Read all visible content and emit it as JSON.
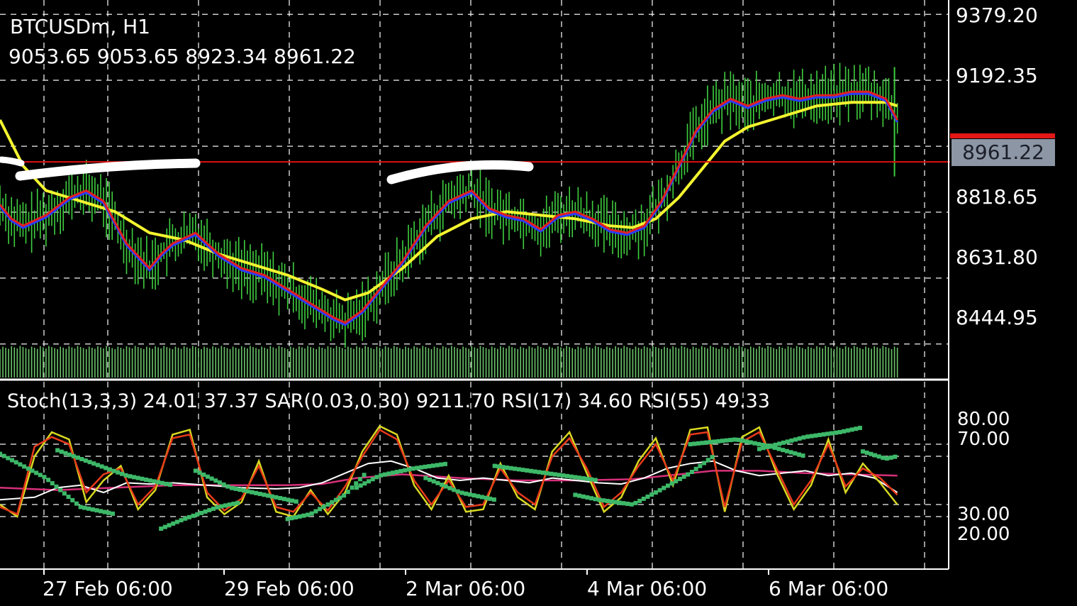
{
  "header": {
    "symbol": "BTCUSDm, H1",
    "ohlc": "9053.65 9053.65 8923.34 8961.22"
  },
  "subwindow": {
    "label": "Stoch(13,3,3) 24.01 37.37 SAR(0.03,0.30) 9211.70 RSI(17) 34.60 RSI(55) 49.33"
  },
  "price_axis": [
    "9379.20",
    "9192.35",
    "8818.65",
    "8631.80",
    "8444.95"
  ],
  "current_price": "8961.22",
  "osc_axis": [
    "80.00",
    "70.00",
    "30.00",
    "20.00"
  ],
  "time_axis": [
    "27 Feb 06:00",
    "29 Feb 06:00",
    "2 Mar 06:00",
    "4 Mar 06:00",
    "6 Mar 06:00"
  ],
  "colors": {
    "background": "#000000",
    "grid": "#ffffff",
    "candles": "#3fcf3f",
    "fast_ma": "#e02020",
    "mid_ma": "#2a3cff",
    "slow_ma": "#f4f430",
    "volume": "#6ac46a",
    "stoch_main": "#e83a1a",
    "stoch_signal": "#d8d822",
    "sar_dots": "#3db868",
    "rsi_fast": "#ffffff",
    "rsi_slow": "#d6307a",
    "current_line": "#e01010"
  },
  "chart_data": {
    "type": "line",
    "title": "BTCUSDm, H1",
    "ylim": [
      8350,
      9420
    ],
    "current": 8961.22,
    "price_path": [
      [
        0,
        8840
      ],
      [
        2,
        8800
      ],
      [
        4,
        8780
      ],
      [
        8,
        8810
      ],
      [
        12,
        8860
      ],
      [
        15,
        8880
      ],
      [
        18,
        8850
      ],
      [
        22,
        8730
      ],
      [
        26,
        8660
      ],
      [
        28,
        8700
      ],
      [
        30,
        8730
      ],
      [
        34,
        8760
      ],
      [
        38,
        8700
      ],
      [
        42,
        8660
      ],
      [
        46,
        8640
      ],
      [
        50,
        8600
      ],
      [
        54,
        8560
      ],
      [
        58,
        8520
      ],
      [
        60,
        8505
      ],
      [
        63,
        8540
      ],
      [
        66,
        8600
      ],
      [
        70,
        8680
      ],
      [
        74,
        8780
      ],
      [
        78,
        8850
      ],
      [
        82,
        8880
      ],
      [
        85,
        8830
      ],
      [
        88,
        8810
      ],
      [
        91,
        8800
      ],
      [
        94,
        8770
      ],
      [
        97,
        8810
      ],
      [
        100,
        8820
      ],
      [
        103,
        8800
      ],
      [
        106,
        8770
      ],
      [
        109,
        8760
      ],
      [
        112,
        8780
      ],
      [
        115,
        8850
      ],
      [
        118,
        8950
      ],
      [
        121,
        9050
      ],
      [
        124,
        9110
      ],
      [
        127,
        9140
      ],
      [
        130,
        9120
      ],
      [
        133,
        9140
      ],
      [
        136,
        9150
      ],
      [
        139,
        9140
      ],
      [
        142,
        9150
      ],
      [
        145,
        9150
      ],
      [
        148,
        9160
      ],
      [
        151,
        9160
      ],
      [
        154,
        9140
      ],
      [
        156,
        9080
      ]
    ],
    "slow_path": [
      [
        0,
        9080
      ],
      [
        4,
        8950
      ],
      [
        8,
        8880
      ],
      [
        14,
        8850
      ],
      [
        20,
        8820
      ],
      [
        26,
        8760
      ],
      [
        32,
        8740
      ],
      [
        38,
        8700
      ],
      [
        44,
        8670
      ],
      [
        50,
        8640
      ],
      [
        56,
        8600
      ],
      [
        60,
        8570
      ],
      [
        64,
        8590
      ],
      [
        70,
        8660
      ],
      [
        76,
        8750
      ],
      [
        82,
        8800
      ],
      [
        88,
        8820
      ],
      [
        94,
        8810
      ],
      [
        100,
        8800
      ],
      [
        106,
        8780
      ],
      [
        110,
        8775
      ],
      [
        114,
        8800
      ],
      [
        118,
        8860
      ],
      [
        122,
        8940
      ],
      [
        126,
        9020
      ],
      [
        130,
        9060
      ],
      [
        136,
        9090
      ],
      [
        142,
        9120
      ],
      [
        148,
        9130
      ],
      [
        154,
        9130
      ],
      [
        156,
        9120
      ]
    ],
    "stochastic": {
      "range": [
        0,
        100
      ],
      "main": [
        [
          0,
          28
        ],
        [
          3,
          22
        ],
        [
          6,
          78
        ],
        [
          9,
          86
        ],
        [
          12,
          80
        ],
        [
          15,
          40
        ],
        [
          18,
          55
        ],
        [
          21,
          60
        ],
        [
          24,
          30
        ],
        [
          27,
          45
        ],
        [
          30,
          85
        ],
        [
          33,
          88
        ],
        [
          36,
          40
        ],
        [
          39,
          25
        ],
        [
          42,
          35
        ],
        [
          45,
          62
        ],
        [
          48,
          28
        ],
        [
          51,
          24
        ],
        [
          54,
          40
        ],
        [
          57,
          25
        ],
        [
          60,
          45
        ],
        [
          63,
          70
        ],
        [
          66,
          92
        ],
        [
          69,
          84
        ],
        [
          72,
          50
        ],
        [
          75,
          30
        ],
        [
          78,
          50
        ],
        [
          81,
          28
        ],
        [
          84,
          30
        ],
        [
          87,
          60
        ],
        [
          90,
          40
        ],
        [
          93,
          30
        ],
        [
          96,
          70
        ],
        [
          99,
          85
        ],
        [
          102,
          60
        ],
        [
          105,
          28
        ],
        [
          108,
          40
        ],
        [
          111,
          62
        ],
        [
          114,
          80
        ],
        [
          117,
          50
        ],
        [
          120,
          88
        ],
        [
          123,
          90
        ],
        [
          126,
          28
        ],
        [
          129,
          82
        ],
        [
          132,
          90
        ],
        [
          135,
          60
        ],
        [
          138,
          30
        ],
        [
          141,
          50
        ],
        [
          144,
          80
        ],
        [
          147,
          45
        ],
        [
          150,
          60
        ],
        [
          153,
          52
        ],
        [
          156,
          38
        ]
      ],
      "signal": [
        [
          0,
          30
        ],
        [
          3,
          20
        ],
        [
          6,
          70
        ],
        [
          9,
          90
        ],
        [
          12,
          84
        ],
        [
          15,
          32
        ],
        [
          18,
          50
        ],
        [
          21,
          62
        ],
        [
          24,
          26
        ],
        [
          27,
          42
        ],
        [
          30,
          88
        ],
        [
          33,
          92
        ],
        [
          36,
          36
        ],
        [
          39,
          22
        ],
        [
          42,
          32
        ],
        [
          45,
          66
        ],
        [
          48,
          24
        ],
        [
          51,
          20
        ],
        [
          54,
          42
        ],
        [
          57,
          22
        ],
        [
          60,
          40
        ],
        [
          63,
          74
        ],
        [
          66,
          95
        ],
        [
          69,
          88
        ],
        [
          72,
          46
        ],
        [
          75,
          26
        ],
        [
          78,
          54
        ],
        [
          81,
          24
        ],
        [
          84,
          26
        ],
        [
          87,
          64
        ],
        [
          90,
          36
        ],
        [
          93,
          26
        ],
        [
          96,
          74
        ],
        [
          99,
          90
        ],
        [
          102,
          56
        ],
        [
          105,
          24
        ],
        [
          108,
          36
        ],
        [
          111,
          66
        ],
        [
          114,
          85
        ],
        [
          117,
          46
        ],
        [
          120,
          92
        ],
        [
          123,
          94
        ],
        [
          126,
          24
        ],
        [
          129,
          86
        ],
        [
          132,
          94
        ],
        [
          135,
          56
        ],
        [
          138,
          26
        ],
        [
          141,
          46
        ],
        [
          144,
          84
        ],
        [
          147,
          40
        ],
        [
          150,
          64
        ],
        [
          153,
          48
        ],
        [
          156,
          30
        ]
      ]
    },
    "rsi17": [
      [
        0,
        34
      ],
      [
        6,
        36
      ],
      [
        10,
        44
      ],
      [
        14,
        46
      ],
      [
        18,
        40
      ],
      [
        22,
        48
      ],
      [
        26,
        47
      ],
      [
        30,
        48
      ],
      [
        36,
        46
      ],
      [
        42,
        44
      ],
      [
        48,
        43
      ],
      [
        52,
        44
      ],
      [
        56,
        48
      ],
      [
        60,
        56
      ],
      [
        64,
        64
      ],
      [
        68,
        66
      ],
      [
        72,
        60
      ],
      [
        76,
        52
      ],
      [
        80,
        50
      ],
      [
        84,
        52
      ],
      [
        88,
        50
      ],
      [
        92,
        48
      ],
      [
        96,
        52
      ],
      [
        100,
        50
      ],
      [
        104,
        48
      ],
      [
        108,
        47
      ],
      [
        112,
        52
      ],
      [
        116,
        60
      ],
      [
        120,
        64
      ],
      [
        124,
        66
      ],
      [
        128,
        58
      ],
      [
        132,
        54
      ],
      [
        136,
        56
      ],
      [
        140,
        58
      ],
      [
        144,
        54
      ],
      [
        148,
        56
      ],
      [
        152,
        52
      ],
      [
        156,
        40
      ]
    ],
    "rsi55": [
      [
        0,
        44
      ],
      [
        10,
        42
      ],
      [
        20,
        44
      ],
      [
        30,
        46
      ],
      [
        40,
        46
      ],
      [
        50,
        46
      ],
      [
        56,
        47
      ],
      [
        62,
        52
      ],
      [
        70,
        55
      ],
      [
        80,
        52
      ],
      [
        90,
        50
      ],
      [
        100,
        50
      ],
      [
        110,
        51
      ],
      [
        116,
        54
      ],
      [
        124,
        58
      ],
      [
        132,
        58
      ],
      [
        140,
        56
      ],
      [
        148,
        55
      ],
      [
        156,
        54
      ]
    ],
    "sar_segments": [
      [
        [
          0,
          72
        ],
        [
          8,
          52
        ],
        [
          14,
          28
        ],
        [
          20,
          22
        ]
      ],
      [
        [
          10,
          75
        ],
        [
          14,
          68
        ],
        [
          22,
          54
        ],
        [
          30,
          46
        ]
      ],
      [
        [
          28,
          10
        ],
        [
          32,
          18
        ],
        [
          38,
          28
        ],
        [
          42,
          32
        ]
      ],
      [
        [
          34,
          58
        ],
        [
          40,
          44
        ],
        [
          46,
          38
        ],
        [
          52,
          32
        ]
      ],
      [
        [
          50,
          18
        ],
        [
          54,
          22
        ],
        [
          60,
          38
        ],
        [
          64,
          58
        ]
      ],
      [
        [
          62,
          44
        ],
        [
          66,
          54
        ],
        [
          72,
          60
        ],
        [
          78,
          64
        ]
      ],
      [
        [
          74,
          52
        ],
        [
          80,
          40
        ],
        [
          86,
          34
        ]
      ],
      [
        [
          86,
          62
        ],
        [
          92,
          58
        ],
        [
          98,
          54
        ],
        [
          104,
          50
        ]
      ],
      [
        [
          100,
          38
        ],
        [
          104,
          34
        ],
        [
          110,
          30
        ],
        [
          114,
          40
        ],
        [
          120,
          56
        ],
        [
          124,
          70
        ]
      ],
      [
        [
          120,
          80
        ],
        [
          128,
          84
        ],
        [
          134,
          78
        ],
        [
          140,
          70
        ]
      ],
      [
        [
          132,
          76
        ],
        [
          140,
          86
        ],
        [
          146,
          90
        ],
        [
          150,
          94
        ]
      ],
      [
        [
          150,
          74
        ],
        [
          154,
          68
        ],
        [
          156,
          70
        ]
      ]
    ]
  }
}
